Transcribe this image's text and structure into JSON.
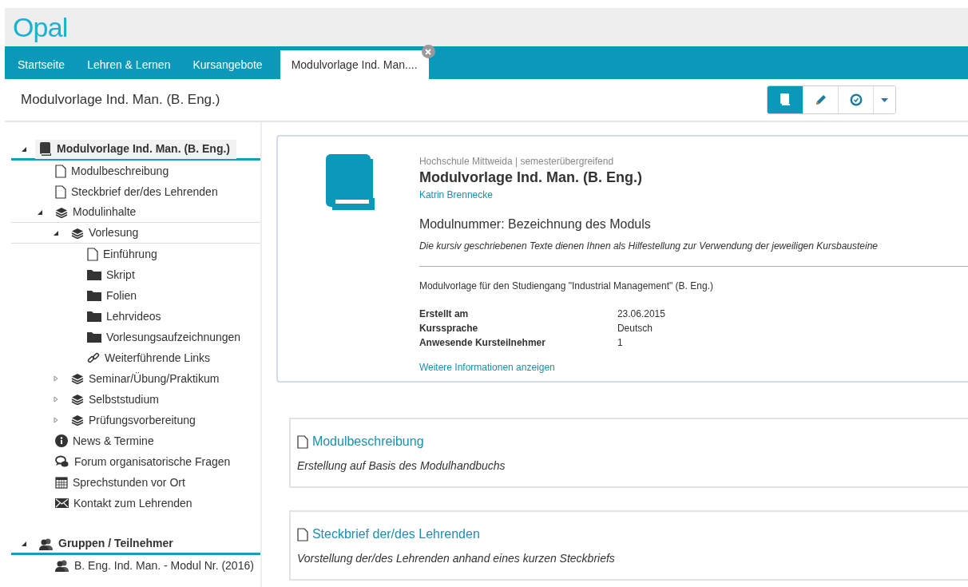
{
  "logo": "Opal",
  "nav_tabs": [
    {
      "label": "Startseite",
      "selected": false,
      "closable": false
    },
    {
      "label": "Lehren & Lernen",
      "selected": false,
      "closable": false
    },
    {
      "label": "Kursangebote",
      "selected": false,
      "closable": false
    },
    {
      "label": "Modulvorlage Ind. Man....",
      "selected": true,
      "closable": true
    }
  ],
  "page_title": "Modulvorlage Ind. Man. (B. Eng.)",
  "toolbar": [
    {
      "kind": "book",
      "selected": true
    },
    {
      "kind": "pencil",
      "selected": false
    },
    {
      "kind": "badge",
      "selected": false
    },
    {
      "kind": "caret",
      "selected": false
    }
  ],
  "trees": [
    {
      "label": "Modulvorlage Ind. Man. (B. Eng.)",
      "kind": "book",
      "expanded": true,
      "selected": true,
      "children": [
        {
          "label": "Modulbeschreibung",
          "kind": "page",
          "selected": false
        },
        {
          "label": "Steckbrief der/des Lehrenden",
          "kind": "page",
          "selected": false
        },
        {
          "label": "Modulinhalte",
          "kind": "layers",
          "expanded": true,
          "selected": false,
          "children": [
            {
              "label": "Vorlesung",
              "kind": "layers",
              "expanded": true,
              "selected": false,
              "children": [
                {
                  "label": "Einführung",
                  "kind": "page",
                  "selected": false
                },
                {
                  "label": "Skript",
                  "kind": "folder",
                  "selected": false
                },
                {
                  "label": "Folien",
                  "kind": "folder",
                  "selected": false
                },
                {
                  "label": "Lehrvideos",
                  "kind": "folder",
                  "selected": false
                },
                {
                  "label": "Vorlesungsaufzeichnungen",
                  "kind": "folder",
                  "selected": false
                },
                {
                  "label": "Weiterführende Links",
                  "kind": "link",
                  "selected": false
                }
              ]
            },
            {
              "label": "Seminar/Übung/Praktikum",
              "kind": "layers",
              "expanded": false,
              "selected": false
            },
            {
              "label": "Selbststudium",
              "kind": "layers",
              "expanded": false,
              "selected": false
            },
            {
              "label": "Prüfungsvorbereitung",
              "kind": "layers",
              "expanded": false,
              "selected": false
            }
          ]
        },
        {
          "label": "News & Termine",
          "kind": "info",
          "selected": false
        },
        {
          "label": "Forum organisatorische Fragen",
          "kind": "forum",
          "selected": false
        },
        {
          "label": "Sprechstunden vor Ort",
          "kind": "calendar",
          "selected": false
        },
        {
          "label": "Kontakt zum Lehrenden",
          "kind": "mail",
          "selected": false
        }
      ]
    },
    {
      "label": "Gruppen / Teilnehmer",
      "kind": "group",
      "expanded": true,
      "selected": false,
      "children": [
        {
          "label": "B. Eng. Ind. Man. - Modul Nr. (2016)",
          "kind": "group",
          "selected": false
        }
      ]
    }
  ],
  "course_info": {
    "institution": "Hochschule Mittweida | semesterübergreifend",
    "title": "Modulvorlage Ind. Man. (B. Eng.)",
    "author": "Katrin Brennecke",
    "heading": "Modulnummer: Bezeichnung des Moduls",
    "hint": "Die kursiv geschriebenen Texte dienen Ihnen als Hilfestellung zur Verwendung der jeweiligen Kursbausteine",
    "description": "Modulvorlage für den Studiengang \"Industrial Management\" (B. Eng.)",
    "details": [
      {
        "label": "Erstellt am",
        "value": "23.06.2015"
      },
      {
        "label": "Kurssprache",
        "value": "Deutsch"
      },
      {
        "label": "Anwesende Kursteilnehmer",
        "value": "1"
      }
    ],
    "more_link": "Weitere Informationen anzeigen"
  },
  "elements": [
    {
      "title": "Modulbeschreibung",
      "description": "Erstellung auf Basis des Modulhandbuchs"
    },
    {
      "title": "Steckbrief der/des Lehrenden",
      "description": "Vorstellung der/des Lehrenden anhand eines kurzen Steckbriefs"
    }
  ]
}
